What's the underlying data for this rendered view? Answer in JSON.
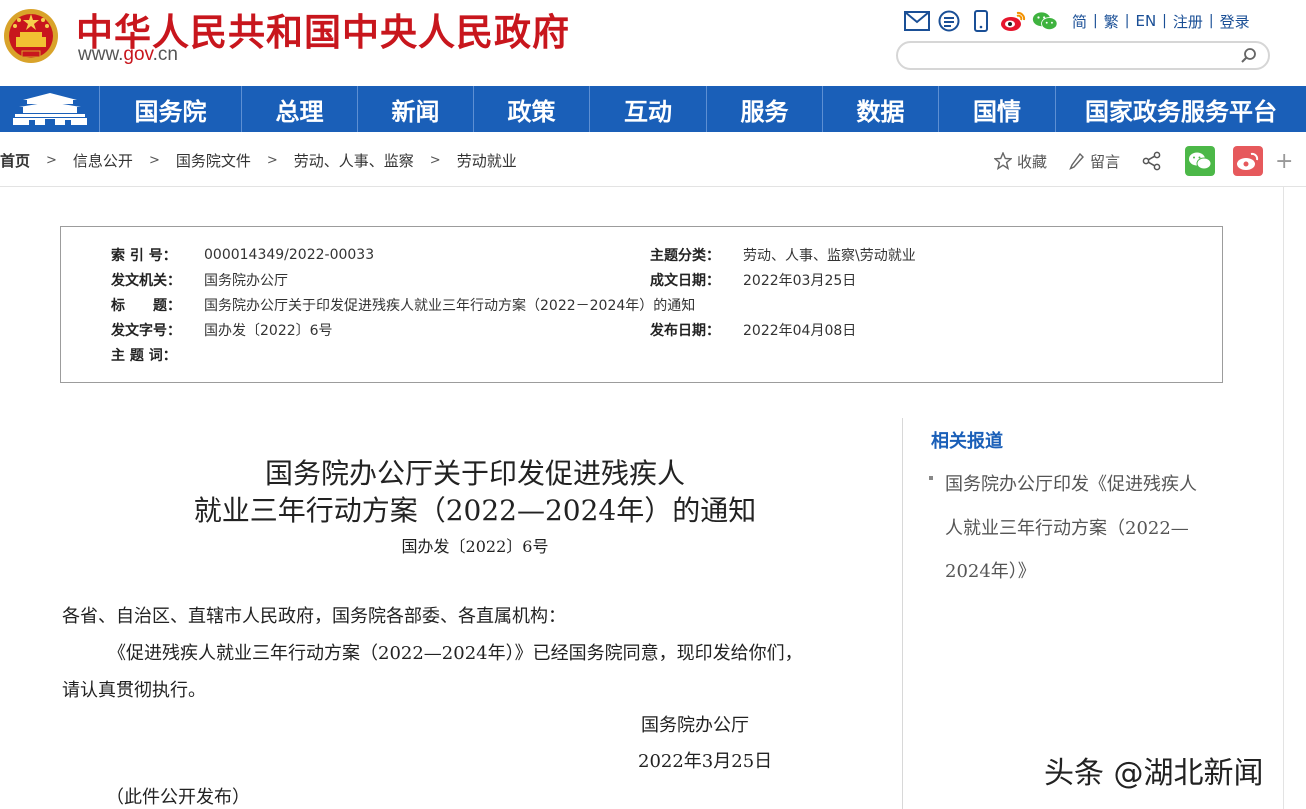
{
  "header": {
    "site_title": "中华人民共和国中央人民政府",
    "site_domain_prefix": "www.",
    "site_domain_main": "gov",
    "site_domain_suffix": ".cn",
    "top_links": [
      "简",
      "繁",
      "EN",
      "注册",
      "登录"
    ],
    "search_placeholder": ""
  },
  "nav": {
    "items": [
      "国务院",
      "总理",
      "新闻",
      "政策",
      "互动",
      "服务",
      "数据",
      "国情",
      "国家政务服务平台"
    ]
  },
  "breadcrumb": [
    "首页",
    "信息公开",
    "国务院文件",
    "劳动、人事、监察",
    "劳动就业"
  ],
  "tools": {
    "favorite": "收藏",
    "comment": "留言"
  },
  "info": {
    "index_label": "索 引 号：",
    "index_value": "000014349/2022-00033",
    "category_label": "主题分类：",
    "category_value": "劳动、人事、监察\\劳动就业",
    "issuer_label": "发文机关：",
    "issuer_value": "国务院办公厅",
    "written_label": "成文日期：",
    "written_value": "2022年03月25日",
    "title_label": "标　　题：",
    "title_value": "国务院办公厅关于印发促进残疾人就业三年行动方案（2022－2024年）的通知",
    "docno_label": "发文字号：",
    "docno_value": "国办发〔2022〕6号",
    "published_label": "发布日期：",
    "published_value": "2022年04月08日",
    "keywords_label": "主 题 词：",
    "keywords_value": ""
  },
  "article": {
    "title_line1": "国务院办公厅关于印发促进残疾人",
    "title_line2": "就业三年行动方案（2022—2024年）的通知",
    "doc_no": "国办发〔2022〕6号",
    "salutation": "各省、自治区、直辖市人民政府，国务院各部委、各直属机构：",
    "body_line1": "《促进残疾人就业三年行动方案（2022—2024年）》已经国务院同意，现印发给你们，",
    "body_line2": "请认真贯彻执行。",
    "signature": "国务院办公厅",
    "date": "2022年3月25日",
    "note": "（此件公开发布）"
  },
  "sidebar": {
    "title": "相关报道",
    "item_line1": "国务院办公厅印发《促进残疾人",
    "item_line2": "人就业三年行动方案（2022—",
    "item_line3": "2024年）》"
  },
  "watermark": "头条 @湖北新闻",
  "colors": {
    "brand_red": "#c8161d",
    "nav_blue": "#1a5fb8",
    "link_blue": "#1a4f96",
    "wechat_green": "#4cb848",
    "weibo_red": "#e6595c"
  },
  "icons": [
    "national-emblem-icon",
    "mail-icon",
    "rss-icon",
    "mobile-icon",
    "weibo-icon",
    "wechat-icon",
    "search-icon",
    "tiananmen-icon",
    "star-icon",
    "pen-icon",
    "share-icon",
    "plus-icon"
  ]
}
